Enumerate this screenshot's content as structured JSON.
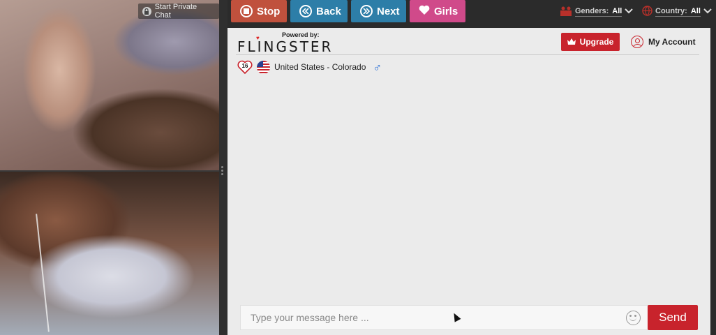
{
  "video": {
    "private_chat_label": "Start Private Chat"
  },
  "toolbar": {
    "stop_label": "Stop",
    "back_label": "Back",
    "next_label": "Next",
    "girls_label": "Girls",
    "genders_label": "Genders:",
    "genders_value": "All",
    "country_label": "Country:",
    "country_value": "All"
  },
  "header": {
    "powered_by": "Powered by:",
    "brand": "FLINGSTER",
    "upgrade_label": "Upgrade",
    "account_label": "My Account"
  },
  "partner": {
    "age": "16",
    "location": "United States - Colorado",
    "gender_icon": "male-icon"
  },
  "composer": {
    "placeholder": "Type your message here ...",
    "send_label": "Send"
  },
  "colors": {
    "stop": "#c0513d",
    "back_next": "#2d7ea8",
    "girls": "#d04a8a",
    "brand_red": "#c8232c"
  }
}
